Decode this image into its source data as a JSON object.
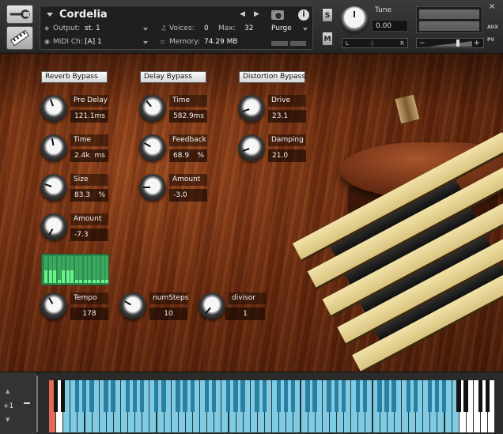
{
  "header": {
    "instrument_name": "Cordelia",
    "output_label": "Output:",
    "output_value": "st. 1",
    "midi_label": "MIDI Ch:",
    "midi_value": "[A]  1",
    "voices_label": "Voices:",
    "voices_value": "0",
    "max_label": "Max:",
    "max_value": "32",
    "memory_label": "Memory:",
    "memory_value": "74.29 MB",
    "purge_label": "Purge",
    "solo_label": "S",
    "mute_label": "M",
    "info_label": "i",
    "tune_label": "Tune",
    "tune_value": "0.00",
    "pan_left": "L",
    "pan_center": "·|·",
    "pan_right": "R",
    "vol_minus": "−",
    "vol_plus": "+",
    "close_label": "×",
    "aux_label": "AUX",
    "pv_label": "PV",
    "nav_prev": "◀",
    "nav_next": "▶",
    "icons": [
      "wrench-icon",
      "keyboard-icon",
      "camera-icon",
      "info-icon",
      "output-icon",
      "midi-icon",
      "voices-icon",
      "memory-icon"
    ]
  },
  "effects": {
    "reverb": {
      "bypass_label": "Reverb Bypass",
      "pre_delay": {
        "label": "Pre Delay",
        "value": "121.1",
        "unit": "ms"
      },
      "time": {
        "label": "Time",
        "value": "2.4k",
        "unit": "ms"
      },
      "size": {
        "label": "Size",
        "value": "83.3",
        "unit": "%"
      },
      "amount": {
        "label": "Amount",
        "value": "-7.3",
        "unit": ""
      }
    },
    "delay": {
      "bypass_label": "Delay Bypass",
      "time": {
        "label": "Time",
        "value": "582.9",
        "unit": "ms"
      },
      "feedback": {
        "label": "Feedback",
        "value": "68.9",
        "unit": "%"
      },
      "amount": {
        "label": "Amount",
        "value": "-3.0",
        "unit": ""
      }
    },
    "distortion": {
      "bypass_label": "Distortion Bypass",
      "drive": {
        "label": "Drive",
        "value": "23.1",
        "unit": ""
      },
      "damping": {
        "label": "Damping",
        "value": "21.0",
        "unit": ""
      }
    }
  },
  "sequencer": {
    "steps": [
      0.45,
      0.45,
      0.45,
      0.1,
      0.45,
      0.45,
      0.45,
      0.1,
      0.1,
      0.1,
      0.1,
      0.1,
      0.1,
      0.1,
      0.1
    ],
    "tempo": {
      "label": "Tempo",
      "value": "178"
    },
    "num_steps": {
      "label": "numSteps",
      "value": "10"
    },
    "divisor": {
      "label": "divisor",
      "value": "1"
    }
  },
  "keyboard": {
    "octave_label": "+1",
    "colors": {
      "mapped": "#7dcbe4",
      "mapped_black": "#2a7ea0",
      "keyswitch": "#e06a55"
    }
  }
}
